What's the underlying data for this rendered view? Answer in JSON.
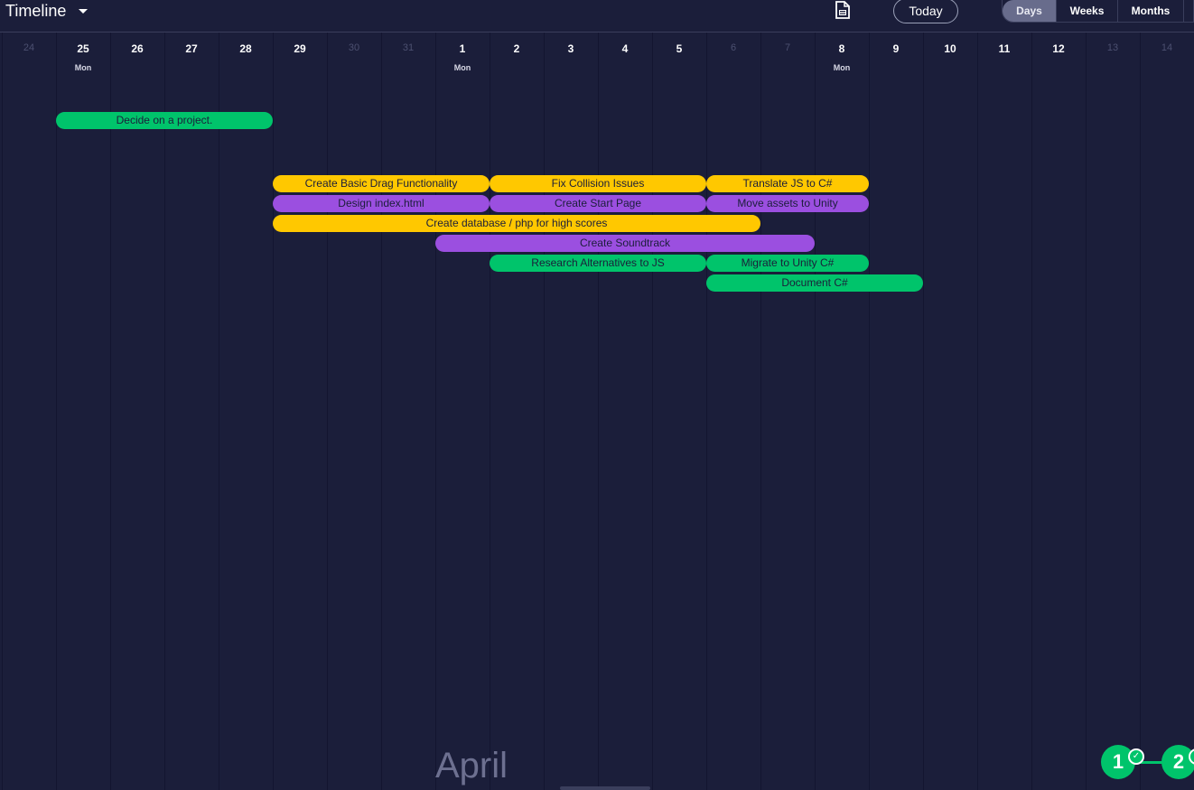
{
  "header": {
    "title": "Timeline",
    "today_label": "Today",
    "views": [
      "Days",
      "Weeks",
      "Months"
    ],
    "active_view": "Days",
    "icons": {
      "title_dropdown": "caret-down-icon",
      "export": "document-icon"
    }
  },
  "days": [
    {
      "num": "24",
      "dow": "",
      "muted": true
    },
    {
      "num": "25",
      "dow": "Mon",
      "muted": false
    },
    {
      "num": "26",
      "dow": "",
      "muted": false
    },
    {
      "num": "27",
      "dow": "",
      "muted": false
    },
    {
      "num": "28",
      "dow": "",
      "muted": false
    },
    {
      "num": "29",
      "dow": "",
      "muted": false
    },
    {
      "num": "30",
      "dow": "",
      "muted": true
    },
    {
      "num": "31",
      "dow": "",
      "muted": true
    },
    {
      "num": "1",
      "dow": "Mon",
      "muted": false
    },
    {
      "num": "2",
      "dow": "",
      "muted": false
    },
    {
      "num": "3",
      "dow": "",
      "muted": false
    },
    {
      "num": "4",
      "dow": "",
      "muted": false
    },
    {
      "num": "5",
      "dow": "",
      "muted": false
    },
    {
      "num": "6",
      "dow": "",
      "muted": true
    },
    {
      "num": "7",
      "dow": "",
      "muted": true
    },
    {
      "num": "8",
      "dow": "Mon",
      "muted": false
    },
    {
      "num": "9",
      "dow": "",
      "muted": false
    },
    {
      "num": "10",
      "dow": "",
      "muted": false
    },
    {
      "num": "11",
      "dow": "",
      "muted": false
    },
    {
      "num": "12",
      "dow": "",
      "muted": false
    },
    {
      "num": "13",
      "dow": "",
      "muted": true
    },
    {
      "num": "14",
      "dow": "",
      "muted": true
    }
  ],
  "tasks": [
    {
      "label": "Decide on a project.",
      "color": "green",
      "start": "25",
      "end": "28"
    },
    {
      "label": "Create Basic Drag Functionality",
      "color": "yellow",
      "start": "29",
      "end": "1"
    },
    {
      "label": "Fix Collision Issues",
      "color": "yellow",
      "start": "2",
      "end": "5"
    },
    {
      "label": "Translate JS to C#",
      "color": "yellow",
      "start": "6",
      "end": "8"
    },
    {
      "label": "Design index.html",
      "color": "purple",
      "start": "29",
      "end": "1"
    },
    {
      "label": "Create Start Page",
      "color": "purple",
      "start": "2",
      "end": "5"
    },
    {
      "label": "Move assets to Unity",
      "color": "purple",
      "start": "6",
      "end": "8"
    },
    {
      "label": "Create database / php for high scores",
      "color": "yellow",
      "start": "29",
      "end": "6"
    },
    {
      "label": "Create Soundtrack",
      "color": "purple",
      "start": "1",
      "end": "7"
    },
    {
      "label": "Research Alternatives to JS",
      "color": "green",
      "start": "2",
      "end": "5"
    },
    {
      "label": "Migrate to Unity C#",
      "color": "green",
      "start": "6",
      "end": "8"
    },
    {
      "label": "Document C#",
      "color": "green",
      "start": "6",
      "end": "9"
    }
  ],
  "month_label": "April",
  "progress_badges": [
    "1",
    "2"
  ],
  "colors": {
    "background": "#1b1e3a",
    "green": "#00c46b",
    "yellow": "#ffc800",
    "purple": "#9b4fe0"
  }
}
